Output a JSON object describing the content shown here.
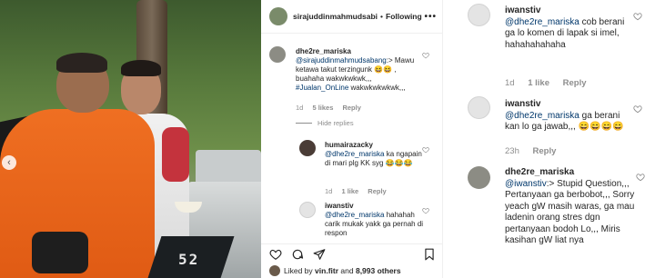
{
  "post": {
    "header": {
      "username": "sirajuddinmahmudsabi",
      "dot": "•",
      "follow": "Following",
      "more": "•••"
    },
    "photo": {
      "scale_text": "52"
    },
    "liked_prefix": "Liked by",
    "liked_user": "vin.fitr",
    "liked_mid": "and",
    "liked_count": "8,993 others",
    "comments": [
      {
        "user": "dhe2re_mariska",
        "mention": "@sirajuddinmahmudsabang",
        "text": ":> Mawu ketawa takut terzingunk 😆😆 , buahaha wakwkwkwk,,, ",
        "tag": "#Jualan_OnLine",
        "tail": " wakwkwkwkwk,,,",
        "time": "1d",
        "likes": "5 likes",
        "reply": "Reply",
        "hide": "Hide replies"
      },
      {
        "user": "humairazacky",
        "mention": "@dhe2re_mariska",
        "text": " ka ngapain di mari plg KK syg 😂😂😂",
        "time": "1d",
        "likes": "1 like",
        "reply": "Reply"
      },
      {
        "user": "iwanstiv",
        "mention": "@dhe2re_mariska",
        "text": " hahahah carik mukak yakk ga pernah di respon",
        "time": "",
        "likes": "",
        "reply": ""
      }
    ]
  },
  "zoom": {
    "comments": [
      {
        "user": "iwanstiv",
        "mention": "@dhe2re_mariska",
        "text": " cob berani ga lo komen di lapak si imel, hahahahahaha",
        "time": "1d",
        "likes": "1 like",
        "reply": "Reply"
      },
      {
        "user": "iwanstiv",
        "mention": "@dhe2re_mariska",
        "text": " ga berani kan lo ga jawab,,, 😄😄😄😄",
        "time": "23h",
        "likes": "",
        "reply": "Reply"
      },
      {
        "user": "dhe2re_mariska",
        "mention": "@iwanstiv",
        "text": ":> Stupid Question,,, Pertanyaan ga berbobot,,, Sorry yeach gW masih waras, ga mau ladenin orang stres dgn pertanyaan bodoh Lo,,, Miris kasihan gW liat nya",
        "time": "",
        "likes": "",
        "reply": ""
      }
    ]
  },
  "icons": [
    "heart-icon",
    "comment-icon",
    "share-icon",
    "bookmark-icon",
    "more-icon",
    "chevron-left-icon"
  ],
  "colors": {
    "link": "#00376b",
    "meta": "#8e8e8e",
    "text": "#262626",
    "divider": "#efefef"
  }
}
